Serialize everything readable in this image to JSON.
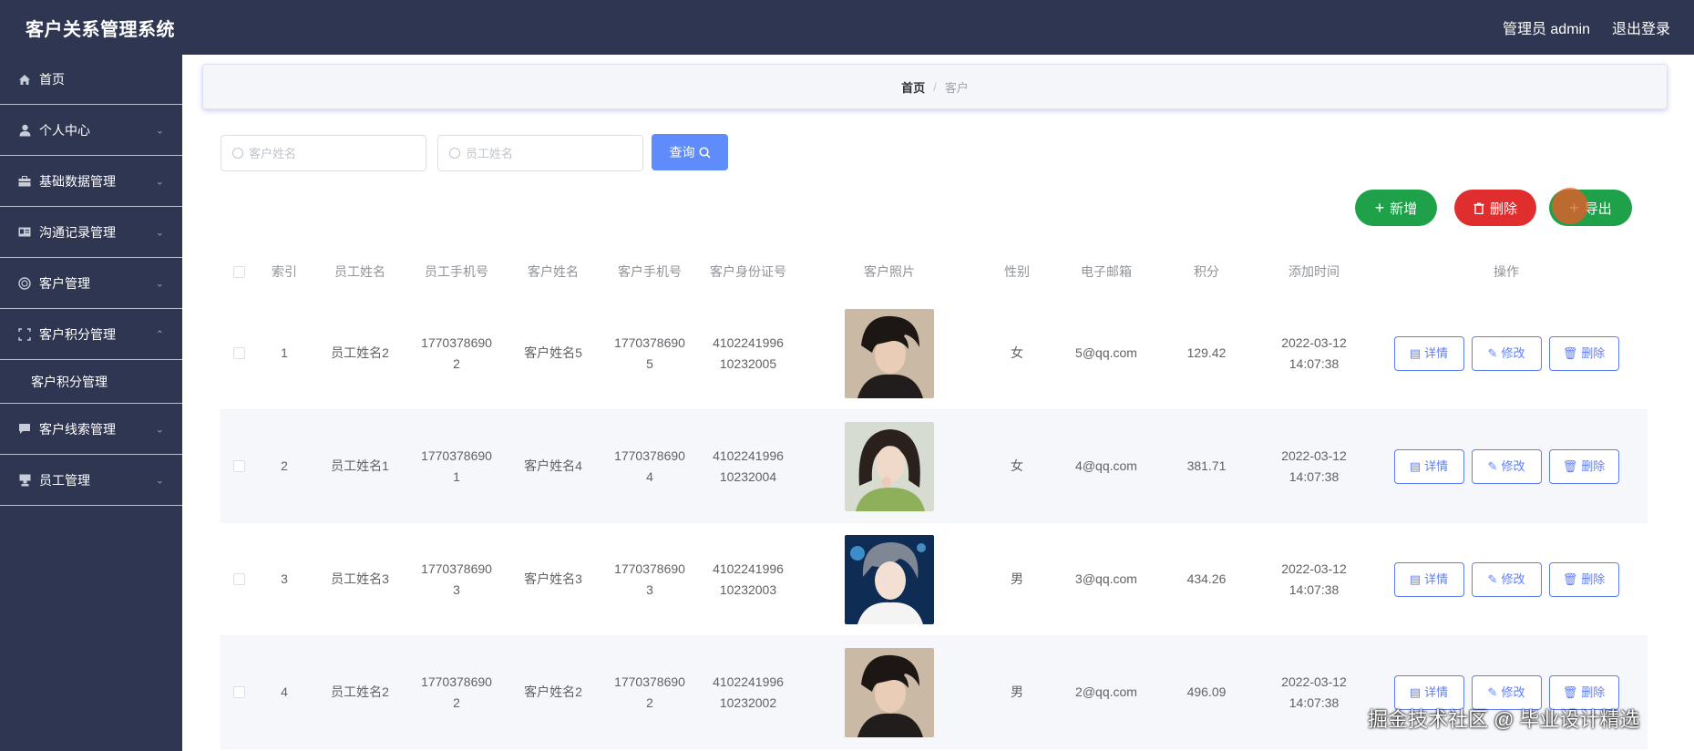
{
  "app": {
    "title": "客户关系管理系统"
  },
  "topbar": {
    "user": "管理员 admin",
    "logout": "退出登录"
  },
  "sidebar": {
    "items": [
      {
        "label": "首页",
        "icon": "home-icon"
      },
      {
        "label": "个人中心",
        "icon": "user-icon"
      },
      {
        "label": "基础数据管理",
        "icon": "briefcase-icon"
      },
      {
        "label": "沟通记录管理",
        "icon": "card-icon"
      },
      {
        "label": "客户管理",
        "icon": "globe-icon"
      },
      {
        "label": "客户积分管理",
        "icon": "crop-icon"
      },
      {
        "label": "客户线索管理",
        "icon": "chat-icon"
      },
      {
        "label": "员工管理",
        "icon": "stamp-icon"
      }
    ],
    "submenu": {
      "label": "客户积分管理"
    }
  },
  "breadcrumb": {
    "home": "首页",
    "separator": "/",
    "current": "客户"
  },
  "search": {
    "customer_placeholder": "客户姓名",
    "employee_placeholder": "员工姓名",
    "query_label": "查询"
  },
  "actions": {
    "add": "新增",
    "delete": "删除",
    "export": "导出"
  },
  "table": {
    "headers": [
      "索引",
      "员工姓名",
      "员工手机号",
      "客户姓名",
      "客户手机号",
      "客户身份证号",
      "客户照片",
      "性别",
      "电子邮箱",
      "积分",
      "添加时间",
      "操作"
    ],
    "op_labels": {
      "detail": "详情",
      "edit": "修改",
      "delete": "删除"
    },
    "rows": [
      {
        "idx": "1",
        "emp": "员工姓名2",
        "ephone_a": "1770378690",
        "ephone_b": "2",
        "cust": "客户姓名5",
        "cphone_a": "1770378690",
        "cphone_b": "5",
        "id_a": "4102241996",
        "id_b": "10232005",
        "gender": "女",
        "email": "5@qq.com",
        "score": "129.42",
        "date": "2022-03-12",
        "time": "14:07:38",
        "photo": "boy-dark"
      },
      {
        "idx": "2",
        "emp": "员工姓名1",
        "ephone_a": "1770378690",
        "ephone_b": "1",
        "cust": "客户姓名4",
        "cphone_a": "1770378690",
        "cphone_b": "4",
        "id_a": "4102241996",
        "id_b": "10232004",
        "gender": "女",
        "email": "4@qq.com",
        "score": "381.71",
        "date": "2022-03-12",
        "time": "14:07:38",
        "photo": "girl-green"
      },
      {
        "idx": "3",
        "emp": "员工姓名3",
        "ephone_a": "1770378690",
        "ephone_b": "3",
        "cust": "客户姓名3",
        "cphone_a": "1770378690",
        "cphone_b": "3",
        "id_a": "4102241996",
        "id_b": "10232003",
        "gender": "男",
        "email": "3@qq.com",
        "score": "434.26",
        "date": "2022-03-12",
        "time": "14:07:38",
        "photo": "boy-blue"
      },
      {
        "idx": "4",
        "emp": "员工姓名2",
        "ephone_a": "1770378690",
        "ephone_b": "2",
        "cust": "客户姓名2",
        "cphone_a": "1770378690",
        "cphone_b": "2",
        "id_a": "4102241996",
        "id_b": "10232002",
        "gender": "男",
        "email": "2@qq.com",
        "score": "496.09",
        "date": "2022-03-12",
        "time": "14:07:38",
        "photo": "boy-dark"
      }
    ]
  },
  "watermark": "掘金技术社区 @ 毕业设计精选",
  "colors": {
    "sidebar": "#2f3651",
    "primary": "#5f8cfb",
    "success": "#1fa14a",
    "danger": "#e02d2d",
    "link": "#5f7ef5"
  }
}
